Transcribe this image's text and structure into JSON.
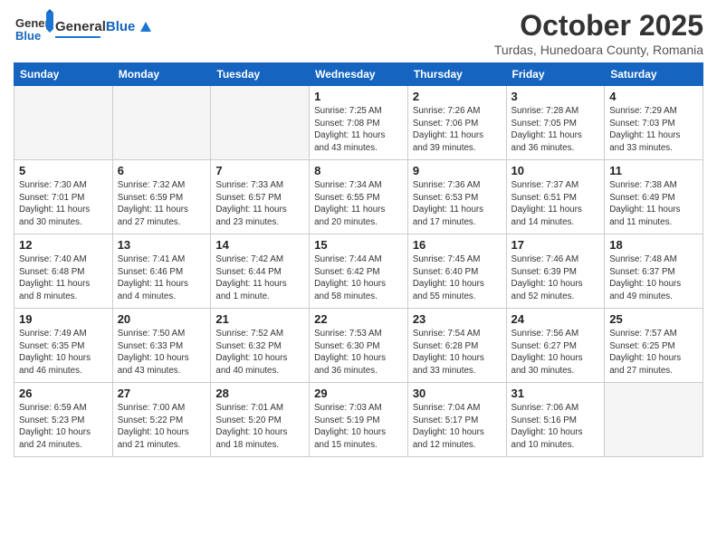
{
  "header": {
    "logo_general": "General",
    "logo_blue": "Blue",
    "month_title": "October 2025",
    "subtitle": "Turdas, Hunedoara County, Romania"
  },
  "days_of_week": [
    "Sunday",
    "Monday",
    "Tuesday",
    "Wednesday",
    "Thursday",
    "Friday",
    "Saturday"
  ],
  "weeks": [
    [
      {
        "day": "",
        "info": ""
      },
      {
        "day": "",
        "info": ""
      },
      {
        "day": "",
        "info": ""
      },
      {
        "day": "1",
        "info": "Sunrise: 7:25 AM\nSunset: 7:08 PM\nDaylight: 11 hours\nand 43 minutes."
      },
      {
        "day": "2",
        "info": "Sunrise: 7:26 AM\nSunset: 7:06 PM\nDaylight: 11 hours\nand 39 minutes."
      },
      {
        "day": "3",
        "info": "Sunrise: 7:28 AM\nSunset: 7:05 PM\nDaylight: 11 hours\nand 36 minutes."
      },
      {
        "day": "4",
        "info": "Sunrise: 7:29 AM\nSunset: 7:03 PM\nDaylight: 11 hours\nand 33 minutes."
      }
    ],
    [
      {
        "day": "5",
        "info": "Sunrise: 7:30 AM\nSunset: 7:01 PM\nDaylight: 11 hours\nand 30 minutes."
      },
      {
        "day": "6",
        "info": "Sunrise: 7:32 AM\nSunset: 6:59 PM\nDaylight: 11 hours\nand 27 minutes."
      },
      {
        "day": "7",
        "info": "Sunrise: 7:33 AM\nSunset: 6:57 PM\nDaylight: 11 hours\nand 23 minutes."
      },
      {
        "day": "8",
        "info": "Sunrise: 7:34 AM\nSunset: 6:55 PM\nDaylight: 11 hours\nand 20 minutes."
      },
      {
        "day": "9",
        "info": "Sunrise: 7:36 AM\nSunset: 6:53 PM\nDaylight: 11 hours\nand 17 minutes."
      },
      {
        "day": "10",
        "info": "Sunrise: 7:37 AM\nSunset: 6:51 PM\nDaylight: 11 hours\nand 14 minutes."
      },
      {
        "day": "11",
        "info": "Sunrise: 7:38 AM\nSunset: 6:49 PM\nDaylight: 11 hours\nand 11 minutes."
      }
    ],
    [
      {
        "day": "12",
        "info": "Sunrise: 7:40 AM\nSunset: 6:48 PM\nDaylight: 11 hours\nand 8 minutes."
      },
      {
        "day": "13",
        "info": "Sunrise: 7:41 AM\nSunset: 6:46 PM\nDaylight: 11 hours\nand 4 minutes."
      },
      {
        "day": "14",
        "info": "Sunrise: 7:42 AM\nSunset: 6:44 PM\nDaylight: 11 hours\nand 1 minute."
      },
      {
        "day": "15",
        "info": "Sunrise: 7:44 AM\nSunset: 6:42 PM\nDaylight: 10 hours\nand 58 minutes."
      },
      {
        "day": "16",
        "info": "Sunrise: 7:45 AM\nSunset: 6:40 PM\nDaylight: 10 hours\nand 55 minutes."
      },
      {
        "day": "17",
        "info": "Sunrise: 7:46 AM\nSunset: 6:39 PM\nDaylight: 10 hours\nand 52 minutes."
      },
      {
        "day": "18",
        "info": "Sunrise: 7:48 AM\nSunset: 6:37 PM\nDaylight: 10 hours\nand 49 minutes."
      }
    ],
    [
      {
        "day": "19",
        "info": "Sunrise: 7:49 AM\nSunset: 6:35 PM\nDaylight: 10 hours\nand 46 minutes."
      },
      {
        "day": "20",
        "info": "Sunrise: 7:50 AM\nSunset: 6:33 PM\nDaylight: 10 hours\nand 43 minutes."
      },
      {
        "day": "21",
        "info": "Sunrise: 7:52 AM\nSunset: 6:32 PM\nDaylight: 10 hours\nand 40 minutes."
      },
      {
        "day": "22",
        "info": "Sunrise: 7:53 AM\nSunset: 6:30 PM\nDaylight: 10 hours\nand 36 minutes."
      },
      {
        "day": "23",
        "info": "Sunrise: 7:54 AM\nSunset: 6:28 PM\nDaylight: 10 hours\nand 33 minutes."
      },
      {
        "day": "24",
        "info": "Sunrise: 7:56 AM\nSunset: 6:27 PM\nDaylight: 10 hours\nand 30 minutes."
      },
      {
        "day": "25",
        "info": "Sunrise: 7:57 AM\nSunset: 6:25 PM\nDaylight: 10 hours\nand 27 minutes."
      }
    ],
    [
      {
        "day": "26",
        "info": "Sunrise: 6:59 AM\nSunset: 5:23 PM\nDaylight: 10 hours\nand 24 minutes."
      },
      {
        "day": "27",
        "info": "Sunrise: 7:00 AM\nSunset: 5:22 PM\nDaylight: 10 hours\nand 21 minutes."
      },
      {
        "day": "28",
        "info": "Sunrise: 7:01 AM\nSunset: 5:20 PM\nDaylight: 10 hours\nand 18 minutes."
      },
      {
        "day": "29",
        "info": "Sunrise: 7:03 AM\nSunset: 5:19 PM\nDaylight: 10 hours\nand 15 minutes."
      },
      {
        "day": "30",
        "info": "Sunrise: 7:04 AM\nSunset: 5:17 PM\nDaylight: 10 hours\nand 12 minutes."
      },
      {
        "day": "31",
        "info": "Sunrise: 7:06 AM\nSunset: 5:16 PM\nDaylight: 10 hours\nand 10 minutes."
      },
      {
        "day": "",
        "info": ""
      }
    ]
  ]
}
